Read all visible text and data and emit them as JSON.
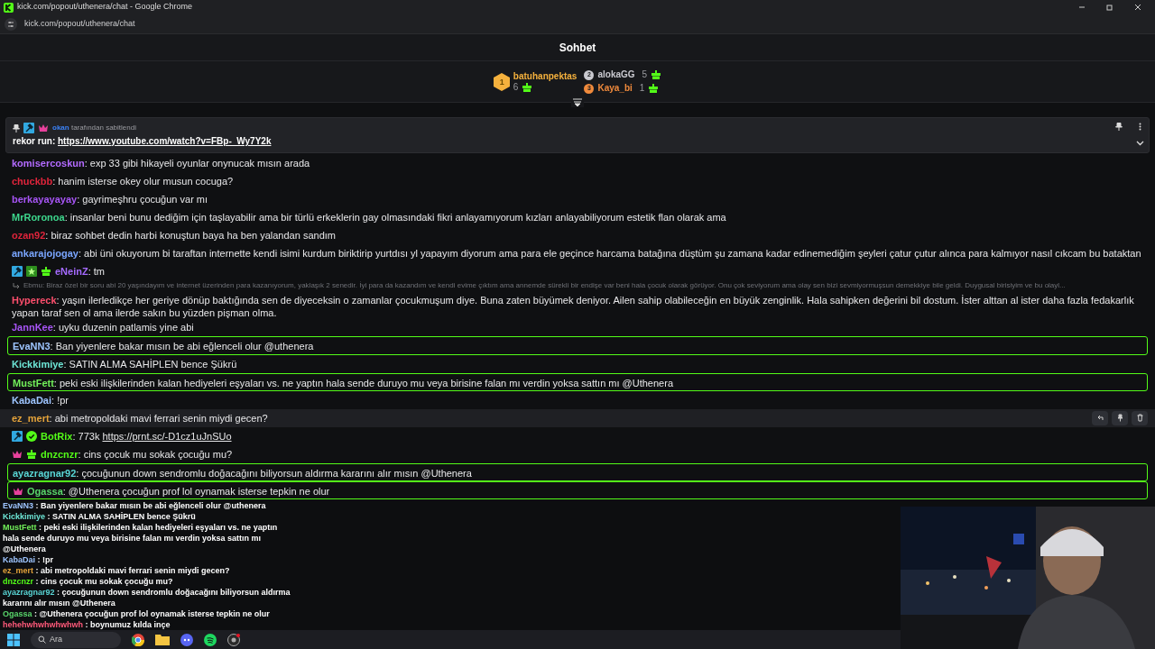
{
  "browser": {
    "title": "kick.com/popout/uthenera/chat - Google Chrome",
    "url": "kick.com/popout/uthenera/chat"
  },
  "chat": {
    "title": "Sohbet",
    "leaderboard": [
      {
        "rank": "1",
        "name": "batuhanpektas",
        "count": "6",
        "color": "#f5b13d"
      },
      {
        "rank": "2",
        "name": "alokaGG",
        "count": "5",
        "color": "#c9c9cf"
      },
      {
        "rank": "3",
        "name": "Kaya_bi",
        "count": "1",
        "color": "#f08a3c"
      }
    ],
    "pinned": {
      "badges": [
        {
          "kind": "mod"
        },
        {
          "kind": "og"
        }
      ],
      "by": "okan",
      "label": "tarafından sabitlendi",
      "prefix": "rekor run:",
      "link": "https://www.youtube.com/watch?v=FBp-_Wy7Y2k"
    },
    "messages": [
      {
        "kind": "message",
        "user": "komisercoskun",
        "color": "#b36bff",
        "text": ": exp 33 gibi hikayeli oyunlar onynucak mısın arada",
        "highlighted": false,
        "hovered": false
      },
      {
        "kind": "message",
        "user": "chuckbb",
        "color": "#e0243b",
        "text": ": hanim isterse okey olur musun cocuga?",
        "highlighted": false,
        "hovered": false
      },
      {
        "kind": "message",
        "user": "berkayayayay",
        "color": "#a855f7",
        "text": ": gayrimeşhru çocuğun var mı",
        "highlighted": false,
        "hovered": false
      },
      {
        "kind": "message",
        "user": "MrRoronoa",
        "color": "#3dd68c",
        "text": ": insanlar beni bunu dediğim için taşlayabilir ama bir türlü erkeklerin gay olmasındaki fikri anlayamıyorum kızları anlayabiliyorum estetik flan olarak ama",
        "highlighted": false,
        "hovered": false
      },
      {
        "kind": "message",
        "user": "ozan92",
        "color": "#e0243b",
        "text": ": biraz sohbet dedin harbi konuştun baya ha ben yalandan sandım",
        "highlighted": false,
        "hovered": false
      },
      {
        "kind": "message",
        "user": "ankarajojogay",
        "color": "#7aa6ff",
        "text": ": abi üni okuyorum bi taraftan internette kendi isimi kurdum biriktirip yurtdısı yl yapayım diyorum ama para ele geçince harcama batağına düştüm şu zamana kadar edinemediğim şeyleri çatur çutur alınca para kalmıyor nasıl cıkcam bu bataktan",
        "highlighted": false,
        "hovered": false
      },
      {
        "kind": "message",
        "user": "eNeinZ",
        "color": "#a56bff",
        "badges": [
          {
            "kind": "mod"
          },
          {
            "kind": "founder"
          },
          {
            "kind": "sub"
          }
        ],
        "text": ": tm",
        "highlighted": false,
        "hovered": false
      },
      {
        "kind": "reply",
        "text": "Ebmu: Biraz özel bir soru abi 20 yaşındayım ve internet üzerinden para kazanıyorum, yaklaşık 2 senedir. İyi para da kazandım ve kendi evime çıktım ama annemde sürekli bir endişe var beni hala çocuk olarak görüyor. Onu çok seviyorum ama olay sen bizi sevmiyormuşsun demekkiye bile geldi. Duygusal birisiyim ve bu olayl..."
      },
      {
        "kind": "message",
        "user": "Hypereck",
        "color": "#ff4f6d",
        "text": ": yaşın ilerledikçe her geriye dönüp baktığında sen de diyeceksin o zamanlar çocukmuşum diye. Buna zaten büyümek deniyor. Ailen sahip olabileceğin en büyük zenginlik. Hala sahipken değerini bil dostum. İster alttan al ister daha fazla fedakarlık yapan taraf sen ol ama ilerde sakın bu yüzden pişman olma.",
        "highlighted": false,
        "hovered": false
      },
      {
        "kind": "message",
        "user": "JannKee",
        "color": "#a855f7",
        "text": ": uyku duzenin patlamis yine abi",
        "highlighted": false,
        "hovered": false
      },
      {
        "kind": "message",
        "user": "EvaNN3",
        "color": "#9ec5ff",
        "text": ": Ban yiyenlere bakar mısın be abi eğlenceli olur @uthenera",
        "highlighted": true,
        "hovered": false
      },
      {
        "kind": "message",
        "user": "Kickkimiye",
        "color": "#6ee7d7",
        "text": ": SATIN ALMA SAHİPLEN bence Şükrü",
        "highlighted": false,
        "hovered": false
      },
      {
        "kind": "message",
        "user": "MustFett",
        "color": "#72f05a",
        "text": ": peki eski ilişkilerinden kalan hediyeleri eşyaları vs. ne yaptın hala sende duruyo mu veya birisine falan mı verdin yoksa sattın mı @Uthenera",
        "highlighted": true,
        "hovered": false
      },
      {
        "kind": "message",
        "user": "KabaDai",
        "color": "#9ec5ff",
        "text": ": !pr",
        "highlighted": false,
        "hovered": false
      },
      {
        "kind": "message",
        "user": "ez_mert",
        "color": "#e5a33a",
        "text": ": abi metropoldaki mavi ferrari senin miydi gecen?",
        "highlighted": false,
        "hovered": true
      },
      {
        "kind": "message",
        "user": "BotRix",
        "color": "#53fc18",
        "badges": [
          {
            "kind": "mod"
          },
          {
            "kind": "verified"
          }
        ],
        "text": ": 773k",
        "link": "https://prnt.sc/-D1cz1uJnSUo",
        "highlighted": false,
        "hovered": false
      },
      {
        "kind": "message",
        "user": "dnzcnzr",
        "color": "#53fc18",
        "badges": [
          {
            "kind": "og"
          },
          {
            "kind": "sub"
          }
        ],
        "text": ": cins çocuk mu sokak çocuğu mu?",
        "highlighted": false,
        "hovered": false
      },
      {
        "kind": "message",
        "user": "ayazragnar92",
        "color": "#59d6d6",
        "text": ": çocuğunun down sendromlu doğacağını biliyorsun aldırma kararını alır mısın @Uthenera",
        "highlighted": true,
        "hovered": false
      },
      {
        "kind": "message",
        "user": "Ogassa",
        "color": "#59d66b",
        "badges": [
          {
            "kind": "og"
          }
        ],
        "text": ": @Uthenera çocuğun prof lol oynamak isterse tepkin ne olur",
        "highlighted": true,
        "hovered": false
      }
    ]
  },
  "overlay": {
    "messages": [
      {
        "user": "EvaNN3",
        "color": "#9ec5ff",
        "text": " : Ban yiyenlere bakar mısın be abi eğlenceli olur @uthenera"
      },
      {
        "user": "Kickkimiye",
        "color": "#6ee7d7",
        "text": " : SATIN ALMA SAHİPLEN bence Şükrü"
      },
      {
        "user": "MustFett",
        "color": "#72f05a",
        "text": " : peki eski ilişkilerinden kalan hediyeleri eşyaları vs. ne yaptın hala sende duruyo mu veya birisine falan mı verdin yoksa sattın mı @Uthenera"
      },
      {
        "user": "KabaDai",
        "color": "#9ec5ff",
        "text": " : !pr"
      },
      {
        "user": "ez_mert",
        "color": "#e5a33a",
        "text": " : abi metropoldaki mavi ferrari senin miydi gecen?"
      },
      {
        "user": "dnzcnzr",
        "color": "#53fc18",
        "text": " : cins çocuk mu sokak çocuğu mu?"
      },
      {
        "user": "ayazragnar92",
        "color": "#59d6d6",
        "text": " : çocuğunun down sendromlu doğacağını biliyorsun aldırma kararını alır mısın @Uthenera"
      },
      {
        "user": "Ogassa",
        "color": "#59d66b",
        "text": " : @Uthenera çocuğun prof lol oynamak isterse tepkin ne olur"
      },
      {
        "user": "hehehwhwhwhwhwh",
        "color": "#ff5a7a",
        "text": " : boynumuz kılda inçe"
      }
    ],
    "taskbar": {
      "search": "Ara"
    }
  }
}
